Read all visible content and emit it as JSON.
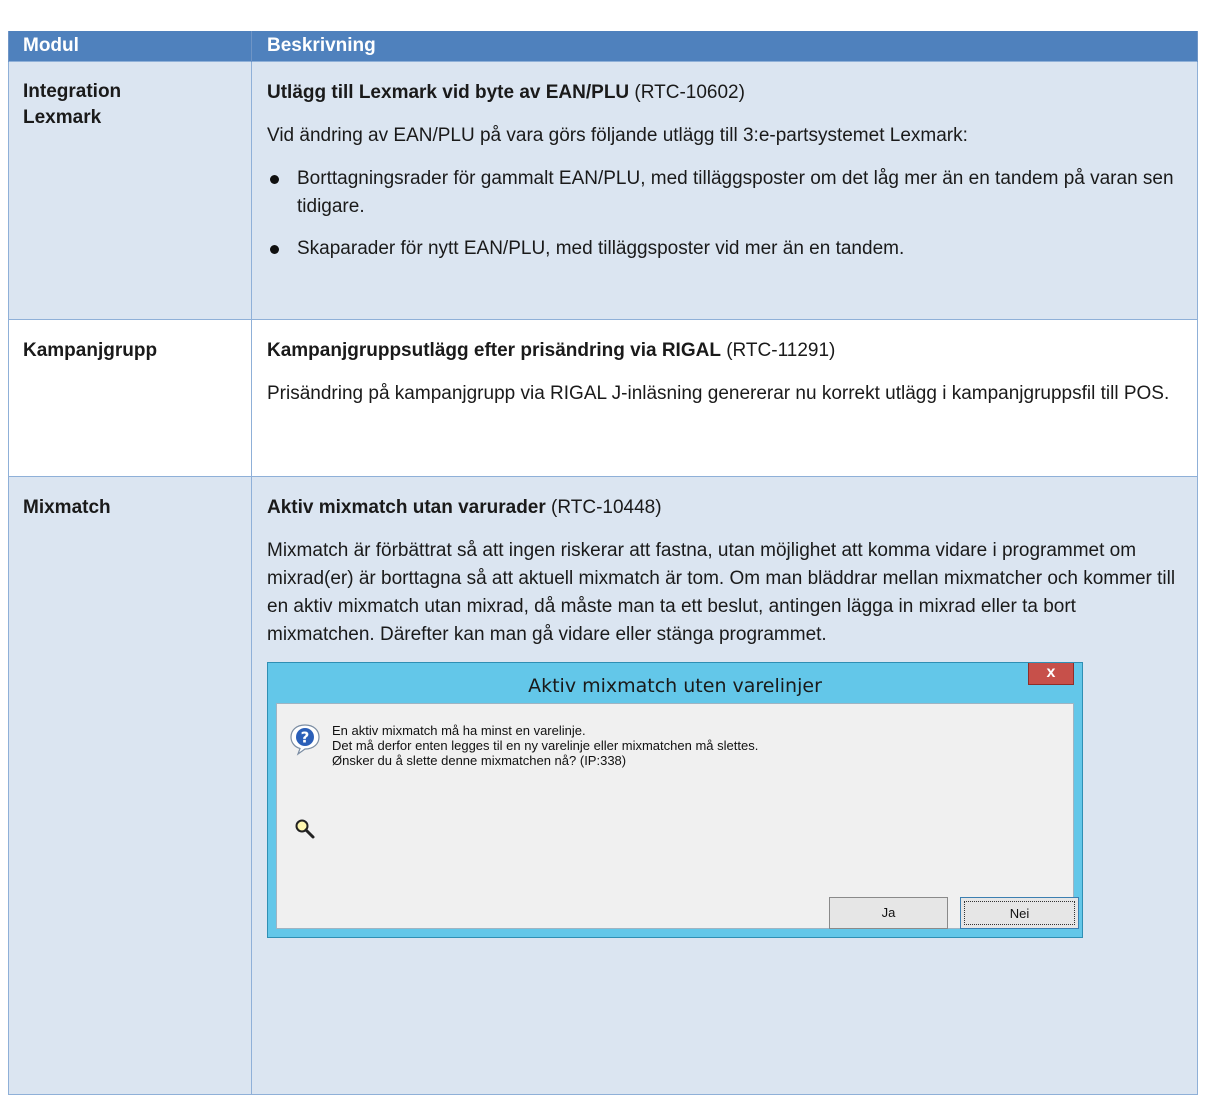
{
  "table": {
    "headers": {
      "module": "Modul",
      "description": "Beskrivning"
    },
    "rows": [
      {
        "module": "Integration Lexmark",
        "title_bold": "Utlägg till Lexmark vid byte av EAN/PLU",
        "title_ref": " (RTC-10602)",
        "paragraph": "Vid ändring av EAN/PLU på vara görs följande utlägg till 3:e-partsystemet Lexmark:",
        "bullets": [
          "Borttagningsrader för gammalt EAN/PLU, med tilläggsposter om det låg mer än en tandem på varan sen tidigare.",
          "Skaparader för nytt EAN/PLU, med tilläggsposter vid mer än en tandem."
        ]
      },
      {
        "module": "Kampanjgrupp",
        "title_bold": "Kampanjgruppsutlägg efter prisändring via RIGAL",
        "title_ref": " (RTC-11291)",
        "paragraph": "Prisändring på kampanjgrupp via RIGAL J-inläsning genererar nu korrekt utlägg i kampanjgruppsfil till POS."
      },
      {
        "module": "Mixmatch",
        "title_bold": "Aktiv mixmatch utan varurader",
        "title_ref": " (RTC-10448)",
        "paragraph": "Mixmatch är förbättrat så att ingen riskerar att fastna, utan möjlighet att komma vidare i programmet om mixrad(er) är borttagna så att aktuell mixmatch är tom. Om man bläddrar mellan mixmatcher och kommer till en aktiv mixmatch utan mixrad, då måste man ta ett beslut, antingen lägga in mixrad eller ta bort mixmatchen. Därefter kan man gå vidare eller stänga programmet."
      }
    ]
  },
  "dialog": {
    "title": "Aktiv mixmatch uten varelinjer",
    "close_label": "x",
    "message_lines": [
      "En aktiv mixmatch må ha minst en varelinje.",
      "Det må derfor enten legges til en ny varelinje eller mixmatchen må slettes.",
      "Ønsker du å slette denne mixmatchen nå? (IP:338)"
    ],
    "yes_label": "Ja",
    "no_label": "Nei"
  },
  "colors": {
    "header_bg": "#4f81bd",
    "shaded_row": "#dbe5f1",
    "dialog_frame": "#63c7e9",
    "close_button": "#c7504a"
  },
  "icons": [
    "question-icon",
    "magnifier-icon",
    "close-icon"
  ]
}
